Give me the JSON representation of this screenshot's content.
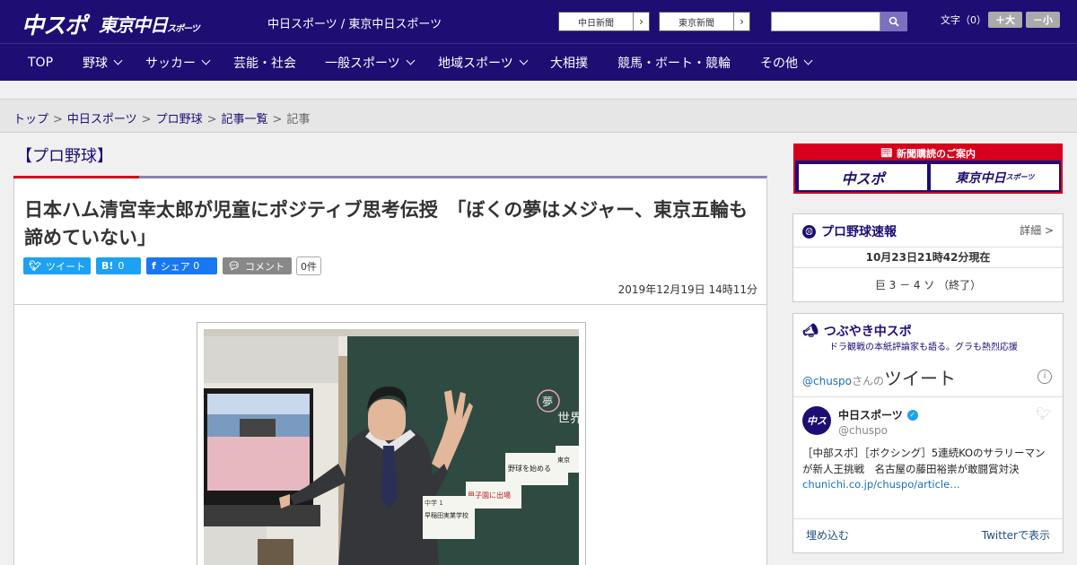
{
  "header": {
    "logo_main": "中スポ",
    "logo_tokyo": "東京中日",
    "logo_tokyo_small": "スポーツ",
    "site_name": "中日スポーツ / 東京中日スポーツ",
    "btn_chunichi": "中日新聞",
    "btn_tokyo": "東京新聞",
    "search_placeholder": "",
    "font_size_label": "文字（0）",
    "font_plus": "＋大",
    "font_minus": "－小"
  },
  "nav": {
    "items": [
      {
        "label": "TOP"
      },
      {
        "label": "野球"
      },
      {
        "label": "サッカー"
      },
      {
        "label": "芸能・社会"
      },
      {
        "label": "一般スポーツ"
      },
      {
        "label": "地域スポーツ"
      },
      {
        "label": "大相撲"
      },
      {
        "label": "競馬・ボート・競輪"
      },
      {
        "label": "その他"
      }
    ]
  },
  "breadcrumb": {
    "items": [
      "トップ",
      "中日スポーツ",
      "プロ野球",
      "記事一覧"
    ],
    "current": "記事",
    "sep": ">"
  },
  "article": {
    "category": "【プロ野球】",
    "title": "日本ハム清宮幸太郎が児童にポジティブ思考伝授　「ぼくの夢はメジャー、東京五輪も諦めていない」",
    "social": {
      "tweet": "ツイート",
      "hatena_label": "B!",
      "hatena_count": "0",
      "facebook": "シェア",
      "facebook_count": "0",
      "comment": "コメント",
      "comment_count": "0件"
    },
    "date": "2019年12月19日 14時11分"
  },
  "sidebar": {
    "subscribe": {
      "title": "新聞購読のご案内",
      "btn1": "中スポ",
      "btn2": "東京中日",
      "btn2_small": "スポーツ"
    },
    "baseball": {
      "title": "プロ野球速報",
      "more": "詳細 >",
      "as_of": "10月23日21時42分現在",
      "score": "巨 3 － 4 ソ （終了）"
    },
    "tweets": {
      "title": "つぶやき中スポ",
      "subtitle": "ドラ観戦の本紙評論家も語る。グラも熱烈応援",
      "header_handle": "@chuspo",
      "header_suffix": "さんの",
      "header_big": "ツイート",
      "name": "中日スポーツ",
      "handle": "@chuspo",
      "text": "［中部スポ］［ボクシング］5連続KOのサラリーマンが新人王挑戦　名古屋の藤田裕崇が敢闘賞対決",
      "link": "chunichi.co.jp/chuspo/article…",
      "embed": "埋め込む",
      "view": "Twitterで表示"
    }
  },
  "photo": {
    "board_text1": "夢",
    "board_text2": "世界",
    "card1": "野球を始める",
    "card2": "甲子園に出場",
    "card3": "早稲田実業学校",
    "card4": "中学 1",
    "card5": "東京"
  },
  "colors": {
    "brand": "#1e0d72",
    "red": "#d6001c",
    "twitter": "#1da1f2",
    "facebook": "#1877f2"
  }
}
